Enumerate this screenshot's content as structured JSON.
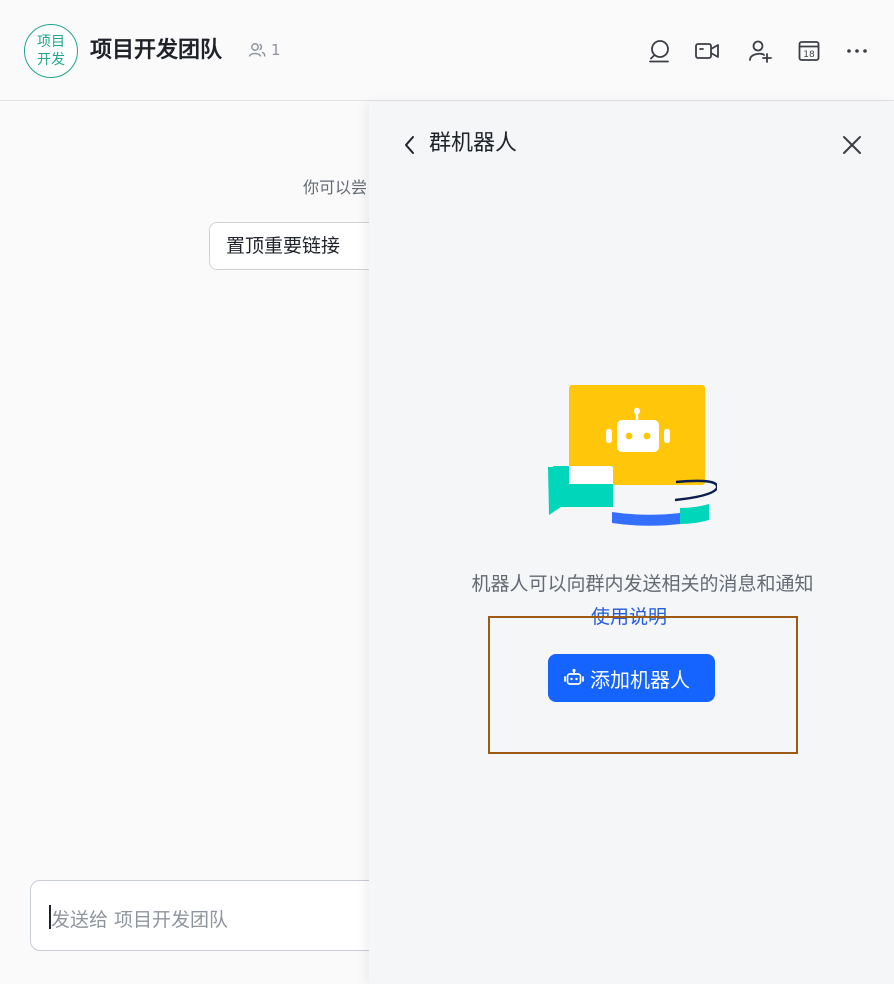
{
  "header": {
    "avatar_line1": "项目",
    "avatar_line2": "开发",
    "group_name": "项目开发团队",
    "member_count": "1",
    "icons": [
      "search-icon",
      "video-call-icon",
      "add-member-icon",
      "calendar-icon",
      "more-icon"
    ],
    "calendar_day": "18"
  },
  "chat": {
    "hint_text": "你可以尝",
    "pin_button": "置顶重要链接",
    "composer_placeholder": "发送给 项目开发团队"
  },
  "panel": {
    "title": "群机器人",
    "description": "机器人可以向群内发送相关的消息和通知",
    "help_link": "使用说明",
    "add_button": "添加机器人"
  },
  "colors": {
    "accent_blue": "#1664ff",
    "link_blue": "#245bdb",
    "avatar_green": "#21a58b",
    "robot_yellow": "#ffc60a",
    "teal": "#00d6b9",
    "highlight_border": "#9c5a12"
  }
}
